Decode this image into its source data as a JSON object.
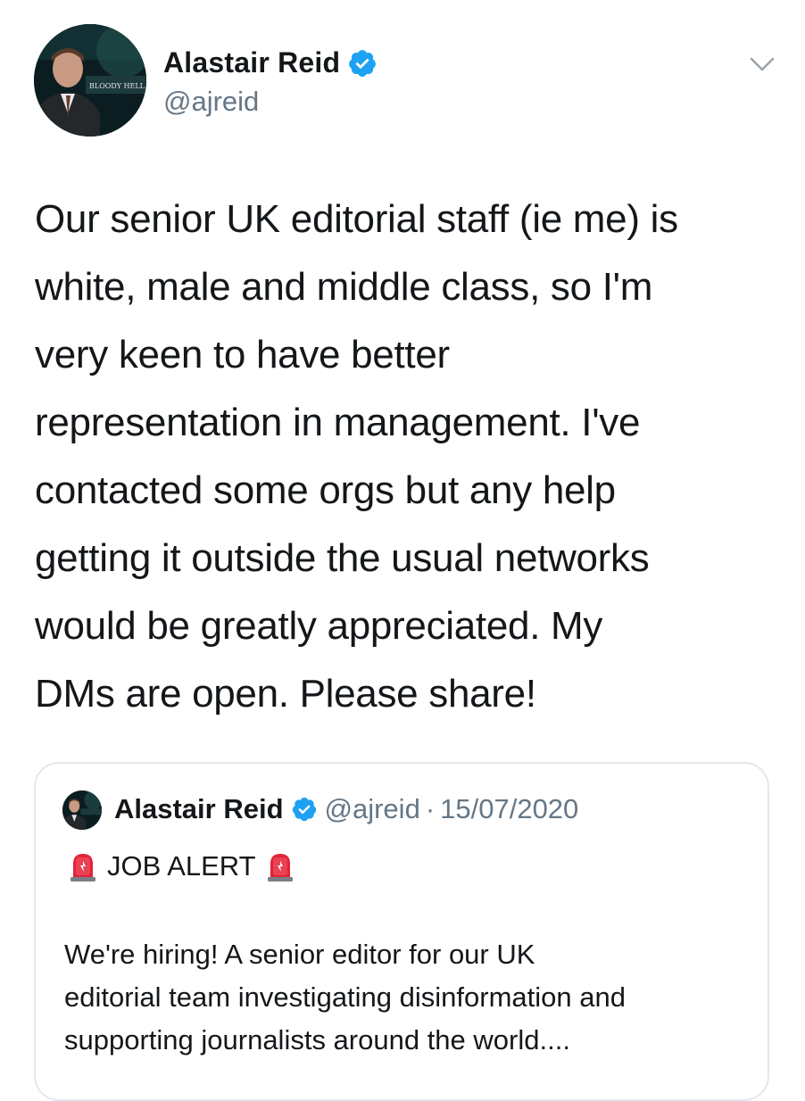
{
  "author": {
    "display_name": "Alastair Reid",
    "handle": "@ajreid",
    "avatar_caption": "BLOODY HELL"
  },
  "tweet": {
    "text": "Our senior UK editorial staff (ie me) is\nwhite, male and middle class, so I'm\nvery keen to have better\nrepresentation in management. I've\ncontacted some orgs but any help\ngetting it outside the usual networks\nwould be greatly appreciated. My\nDMs are open. Please share!"
  },
  "quote": {
    "display_name": "Alastair Reid",
    "handle": "@ajreid",
    "separator": "·",
    "date": "15/07/2020",
    "alert_label": "JOB ALERT",
    "body": "We're hiring! A senior editor for our UK\neditorial team investigating disinformation and\nsupporting journalists around the world...."
  },
  "icons": {
    "verified": "verified-badge-icon",
    "menu": "chevron-down-icon",
    "alert": "rotating-light-siren-icon"
  },
  "colors": {
    "verified_blue": "#1da1f2",
    "secondary_text": "#657786",
    "border": "#e1e8ed",
    "siren_red": "#e0243a"
  }
}
